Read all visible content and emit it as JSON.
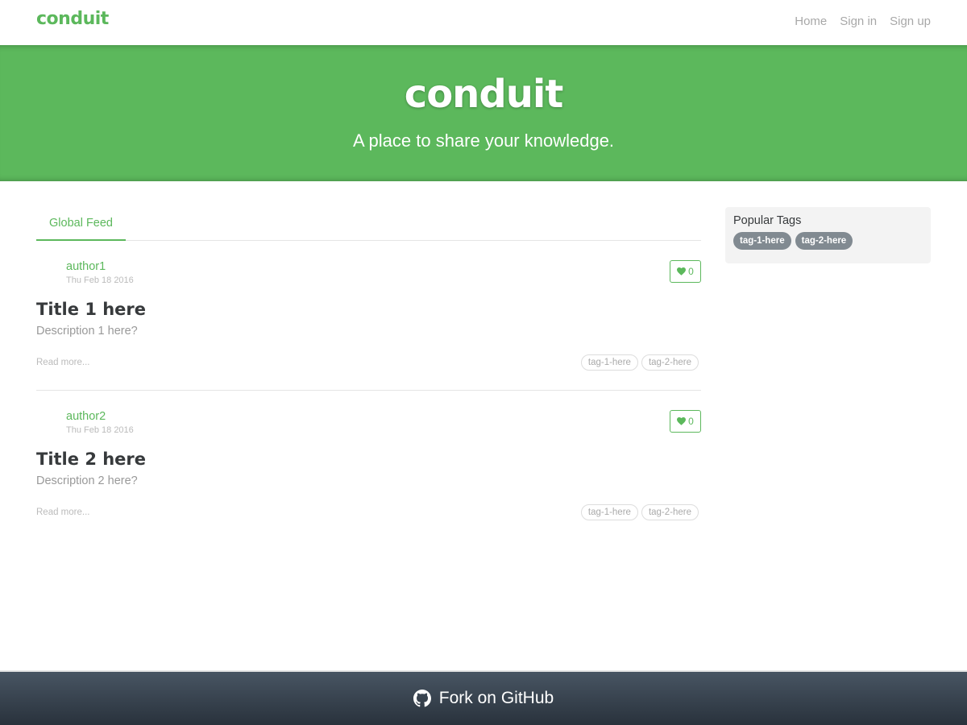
{
  "navbar": {
    "brand": "conduit",
    "links": [
      {
        "label": "Home"
      },
      {
        "label": "Sign in"
      },
      {
        "label": "Sign up"
      }
    ]
  },
  "banner": {
    "title": "conduit",
    "subtitle": "A place to share your knowledge."
  },
  "feed": {
    "tab_label": "Global Feed",
    "articles": [
      {
        "author": "author1",
        "date": "Thu Feb 18 2016",
        "favorites": "0",
        "title": "Title 1 here",
        "description": "Description 1 here?",
        "read_more": "Read more...",
        "tags": [
          "tag-1-here",
          "tag-2-here"
        ]
      },
      {
        "author": "author2",
        "date": "Thu Feb 18 2016",
        "favorites": "0",
        "title": "Title 2 here",
        "description": "Description 2 here?",
        "read_more": "Read more...",
        "tags": [
          "tag-1-here",
          "tag-2-here"
        ]
      }
    ]
  },
  "sidebar": {
    "title": "Popular Tags",
    "tags": [
      "tag-1-here",
      "tag-2-here"
    ]
  },
  "footer": {
    "label": "Fork on GitHub",
    "icon": "github-icon"
  },
  "colors": {
    "accent": "#5cb85c",
    "tag_pill": "#818a91",
    "footer_top": "#485563",
    "footer_bottom": "#29323c"
  }
}
